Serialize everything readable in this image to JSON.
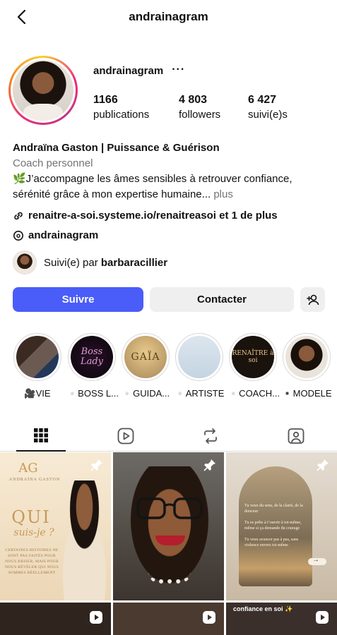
{
  "header": {
    "title": "andrainagram"
  },
  "profile": {
    "username": "andrainagram",
    "more": "···",
    "stats": [
      {
        "num": "1166",
        "label": "publications"
      },
      {
        "num": "4 803",
        "label": "followers"
      },
      {
        "num": "6 427",
        "label": "suivi(e)s"
      }
    ]
  },
  "bio": {
    "name": "Andraïna Gaston | Puissance & Guérison",
    "category": "Coach personnel",
    "text": "🌿J’accompagne les âmes sensibles à retrouver confiance, sérénité grâce à mon expertise humaine...",
    "more": "plus",
    "link": "renaitre-a-soi.systeme.io/renaitreasoi et 1 de plus",
    "threads": "andrainagram"
  },
  "followed_by": {
    "prefix": "Suivi(e) par",
    "user": "barbaracillier"
  },
  "actions": {
    "follow": "Suivre",
    "contact": "Contacter"
  },
  "highlights": [
    {
      "label": "🎥VIE",
      "thumb_text": ""
    },
    {
      "label": "▫️BOSS L...",
      "thumb_text": "Boss Lady"
    },
    {
      "label": "▫️GUIDA...",
      "thumb_text": "GAÏA"
    },
    {
      "label": "▫️ARTISTE",
      "thumb_text": ""
    },
    {
      "label": "▫️COACH...",
      "thumb_text": "RENAÎTRE à soi"
    },
    {
      "label": "▪️MODELE",
      "thumb_text": ""
    }
  ],
  "posts": {
    "p1": {
      "logo": "AG",
      "brand": "ANDRAÏNA GASTON",
      "title": "QUI",
      "subtitle": "suis-je ?",
      "small": "CERTAINES HISTOIRES NE SONT PAS FAITES POUR NOUS BRISER, MAIS POUR NOUS RÉVÉLER QUI NOUS SOMMES RÉELLEMENT"
    },
    "p3": {
      "lines": [
        "Tu veux du sens, de la clarté, de la douceur",
        "Tu es prête à t’ouvrir à toi-même, même si ça demande du courage",
        "Tu veux avancer pas à pas, sans violence envers toi-même"
      ]
    },
    "p6": {
      "caption": "confiance en soi ✨"
    }
  },
  "colors": {
    "follow_button": "#4a5df9",
    "secondary_button": "#efefef",
    "muted_text": "#737373"
  }
}
